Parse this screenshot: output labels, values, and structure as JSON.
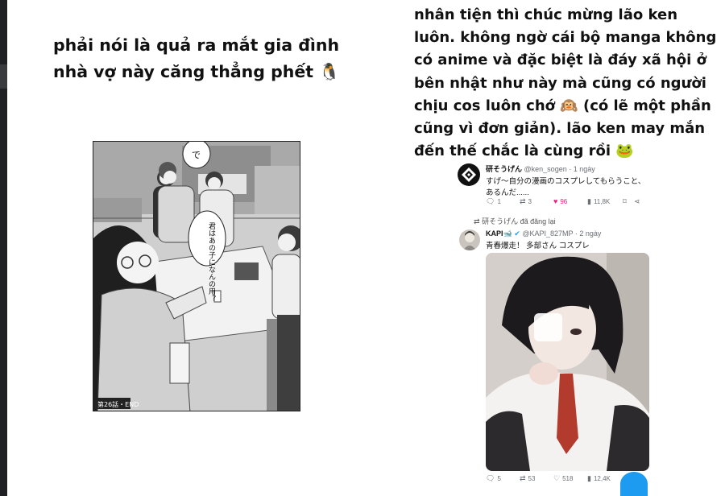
{
  "captions": {
    "left": "phải nói là quả ra mắt gia đình nhà vợ này căng thẳng phết 🐧",
    "right": "nhân tiện thì chúc mừng lão ken luôn. không ngờ cái bộ manga không có anime và đặc biệt là đáy xã hội ở bên nhật như này mà cũng có người chịu cos luôn chớ 🙉 (có lẽ một phần cũng vì đơn giản). lão ken may mắn đến thế chắc là cùng rồi 🐸"
  },
  "manga": {
    "speech_bubble_1": "で",
    "speech_bubble_2": "君はあの子になんの用？",
    "chapter_label": "第26話・END"
  },
  "tweet1": {
    "name": "研そうげん",
    "handle": "@ken_sogen",
    "time": "· 1 ngày",
    "text_line1": "すげ〜自分の漫画のコスプレしてもらうこと、",
    "text_line2": "あるんだ......",
    "replies": "1",
    "reposts": "3",
    "likes": "96",
    "views": "11,8K"
  },
  "repost_note": "研そうげん đã đăng lại",
  "tweet2": {
    "name": "KAPI",
    "name_emoji": "🐋",
    "handle": "@KAPI_827MP",
    "time": "· 2 ngày",
    "text": "青春爆走！ 多部さん コスプレ",
    "replies": "5",
    "reposts": "53",
    "likes": "518",
    "views": "12,4K"
  },
  "colors": {
    "like_active": "#f91880",
    "blue_accent": "#1d9bf0",
    "text_dark": "#111111",
    "text_muted": "#6b6f74"
  },
  "icons": [
    "reply-icon",
    "repost-icon",
    "heart-icon",
    "views-icon",
    "bookmark-icon",
    "share-icon",
    "verified-badge-icon"
  ]
}
